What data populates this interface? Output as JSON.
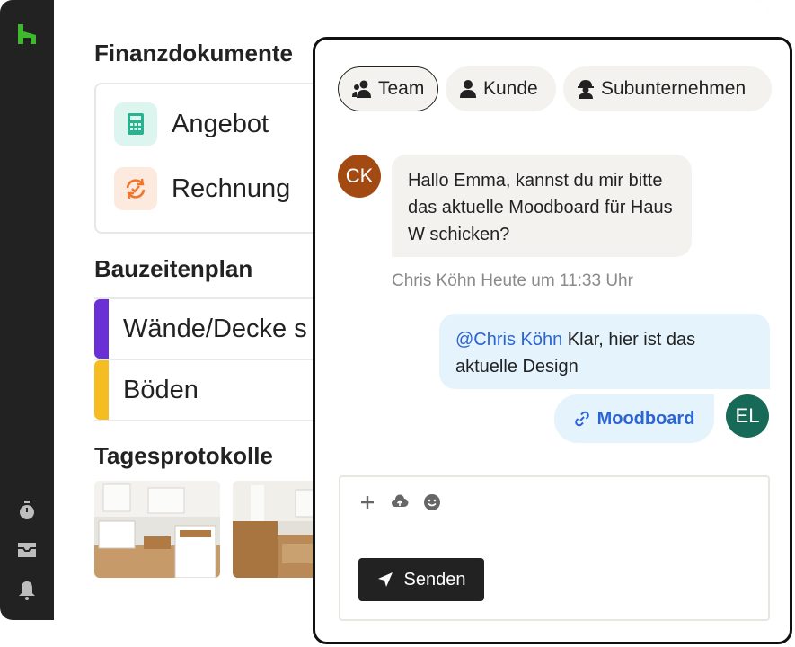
{
  "app": {
    "sections": {
      "finance_title": "Finanzdokumente",
      "schedule_title": "Bauzeitenplan",
      "logs_title": "Tagesprotokolle"
    },
    "finance_items": [
      {
        "label": "Angebot",
        "icon": "calculator-icon"
      },
      {
        "label": "Rechnung",
        "icon": "sync-icon"
      }
    ],
    "schedule_items": [
      {
        "label": "Wände/Decke s",
        "color": "#6b2fd6"
      },
      {
        "label": "Böden",
        "color": "#f6bd23"
      }
    ]
  },
  "chat": {
    "tabs": [
      {
        "label": "Team",
        "active": true
      },
      {
        "label": "Kunde",
        "active": false
      },
      {
        "label": "Subunternehmen",
        "active": false
      }
    ],
    "incoming": {
      "avatar": "CK",
      "avatar_color": "#a34a12",
      "text": "Hallo Emma, kannst du mir bitte das aktuelle Moodboard für Haus W schicken?",
      "meta": "Chris Köhn Heute um 11:33 Uhr"
    },
    "outgoing": {
      "mention": "@Chris Köhn",
      "text": " Klar, hier ist das aktuelle Design",
      "attachment": "Moodboard",
      "avatar": "EL",
      "avatar_color": "#176a57"
    },
    "composer": {
      "send_label": "Senden"
    }
  },
  "colors": {
    "brand_green": "#3dba2c",
    "sidebar": "#222222",
    "link_blue": "#2b64d3"
  }
}
